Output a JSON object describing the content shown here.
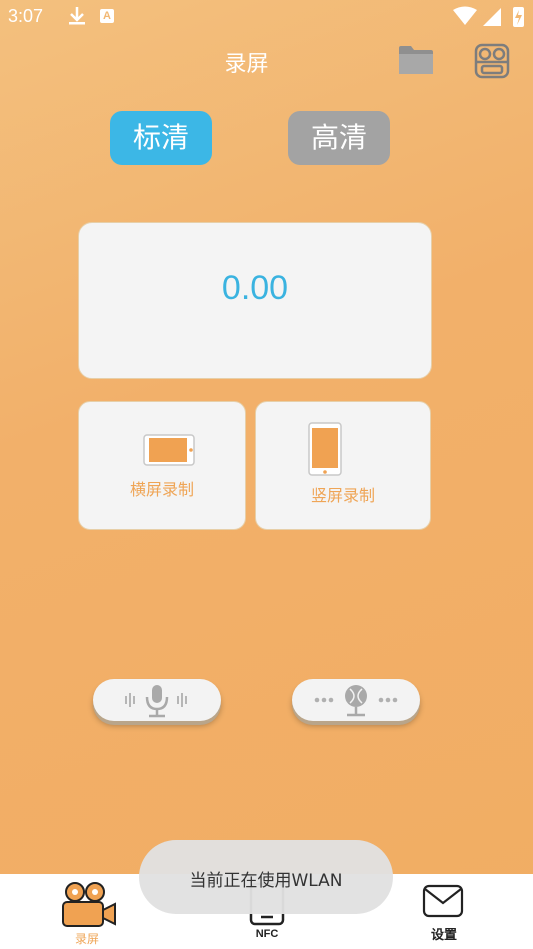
{
  "status_bar": {
    "time": "3:07",
    "notification_letter": "A"
  },
  "header": {
    "title": "录屏"
  },
  "quality": {
    "sd_label": "标清",
    "hd_label": "高清"
  },
  "timer": {
    "value": "0.00"
  },
  "record_modes": {
    "landscape_label": "横屏录制",
    "portrait_label": "竖屏录制"
  },
  "bottom_nav": {
    "record_label": "录屏",
    "nfc_label": "NFC",
    "settings_label": "设置"
  },
  "toast": {
    "text": "当前正在使用WLAN"
  },
  "colors": {
    "accent_blue": "#3cb7e6",
    "accent_orange": "#efa556",
    "inactive_gray": "#a3a3a3"
  }
}
